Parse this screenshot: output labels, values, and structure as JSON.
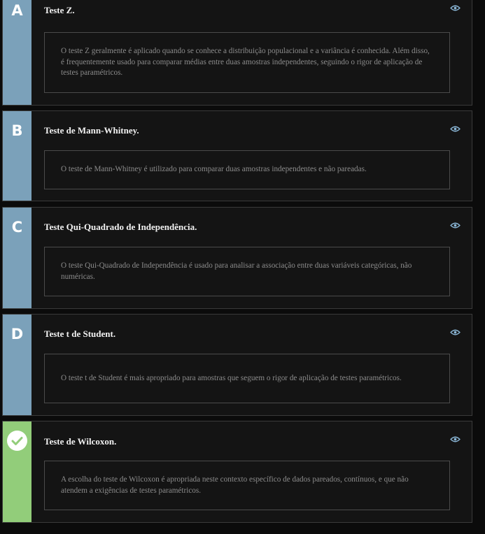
{
  "options": [
    {
      "letter": "A",
      "title": "Teste Z.",
      "explanation": "O teste Z geralmente é aplicado quando se conhece a distribuição populacional e a variância é conhecida. Além disso, é frequentemente usado para comparar médias entre duas amostras independentes, seguindo o rigor de aplicação de testes paramétricos.",
      "correct": false
    },
    {
      "letter": "B",
      "title": "Teste de Mann-Whitney.",
      "explanation": "O teste de Mann-Whitney é utilizado para comparar duas amostras independentes e não pareadas.",
      "correct": false
    },
    {
      "letter": "C",
      "title": "Teste Qui-Quadrado de Independência.",
      "explanation": "O teste Qui-Quadrado de Independência é usado para analisar a associação entre duas variáveis categóricas, não numéricas.",
      "correct": false
    },
    {
      "letter": "D",
      "title": "Teste t de Student.",
      "explanation": "O teste t de Student é mais apropriado para amostras que seguem o rigor de aplicação de testes paramétricos.",
      "correct": false
    },
    {
      "letter": "",
      "title": "Teste de Wilcoxon.",
      "explanation": "A escolha do teste de Wilcoxon é apropriada neste contexto específico de dados pareados, contínuos, e que não atendem a exigências de testes paramétricos.",
      "correct": true
    }
  ],
  "colors": {
    "letter_bar": "#7ba1ba",
    "correct_bar": "#92cd7a",
    "eye_icon": "#8ab6d6"
  },
  "icons": {
    "toggle": "eye-icon",
    "correct_marker": "check-icon"
  }
}
